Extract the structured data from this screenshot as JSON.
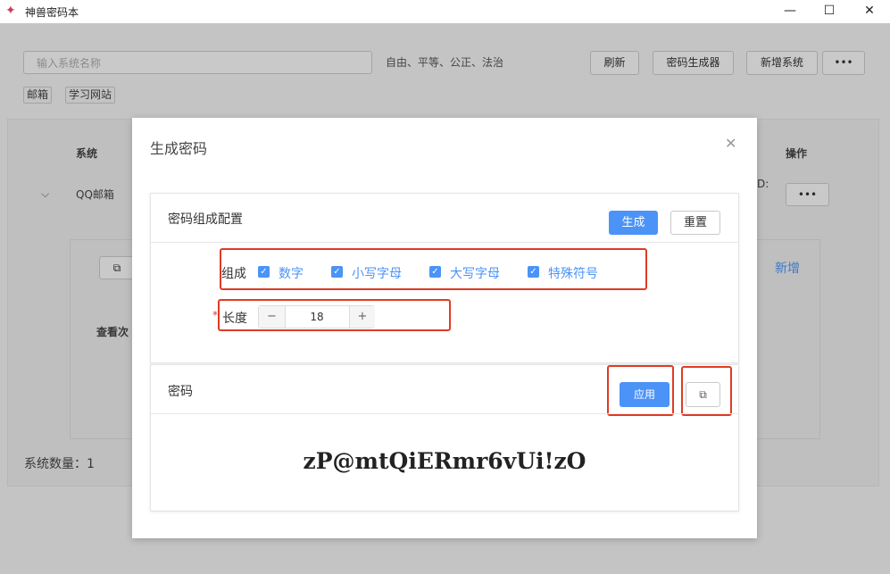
{
  "app": {
    "title": "神兽密码本",
    "minimize": "—",
    "maximize": "☐",
    "close": "✕"
  },
  "background": {
    "search_placeholder": "输入系统名称",
    "slogan": "自由、平等、公正、法治",
    "buttons": {
      "refresh": "刷新",
      "password_generator": "密码生成器",
      "add_system": "新增系统",
      "more": "•••"
    },
    "tags": [
      "邮箱",
      "学习网站"
    ],
    "table": {
      "col_system": "系统",
      "col_action": "操作",
      "row_name": "QQ邮箱",
      "row_more": "•••",
      "row_colon": "D:"
    },
    "sub": {
      "add": "新增",
      "view": "查看次"
    },
    "count_label": "系统数量：1"
  },
  "dialog": {
    "title": "生成密码",
    "config": {
      "title": "密码组成配置",
      "generate": "生成",
      "reset": "重置",
      "composition_label": "组成",
      "options": [
        {
          "label": "数字",
          "checked": true
        },
        {
          "label": "小写字母",
          "checked": true
        },
        {
          "label": "大写字母",
          "checked": true
        },
        {
          "label": "特殊符号",
          "checked": true
        }
      ],
      "required_mark": "*",
      "length_label": "长度",
      "length_value": "18",
      "minus": "−",
      "plus": "+"
    },
    "password": {
      "title": "密码",
      "apply": "应用",
      "value": "zP@mtQiERmr6vUi!zO"
    }
  },
  "colors": {
    "primary": "#4b93f7",
    "highlight": "#e03b24"
  }
}
